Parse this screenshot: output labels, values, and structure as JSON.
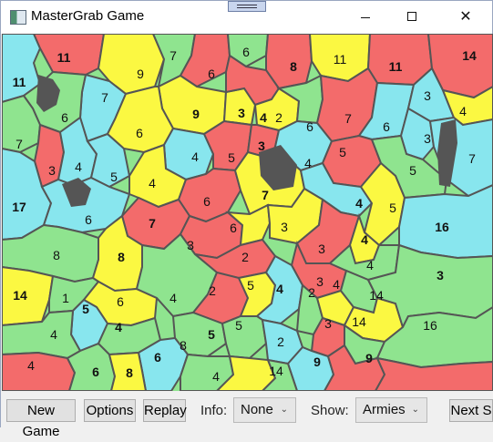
{
  "window": {
    "title": "MasterGrab Game",
    "controls": [
      "minimize",
      "maximize",
      "close"
    ]
  },
  "toolbar": {
    "new_game": "New Game",
    "options": "Options",
    "replay": "Replay",
    "info_label": "Info:",
    "info_value": "None",
    "show_label": "Show:",
    "show_value": "Armies",
    "next": "Next S"
  },
  "map": {
    "colors": {
      "red": "#f36b6b",
      "yellow": "#fbf842",
      "cyan": "#88e6ee",
      "green": "#8fe48f",
      "border": "#555555"
    },
    "regions": [
      {
        "label": "11",
        "bold": true
      },
      {
        "label": "11",
        "bold": true
      },
      {
        "label": "9",
        "bold": false
      },
      {
        "label": "7",
        "bold": false
      },
      {
        "label": "6",
        "bold": false
      },
      {
        "label": "6",
        "bold": false
      },
      {
        "label": "8",
        "bold": true
      },
      {
        "label": "11",
        "bold": false
      },
      {
        "label": "11",
        "bold": true
      },
      {
        "label": "14",
        "bold": true
      },
      {
        "label": "7",
        "bold": false
      },
      {
        "label": "6",
        "bold": false
      },
      {
        "label": "9",
        "bold": true
      },
      {
        "label": "3",
        "bold": true
      },
      {
        "label": "4",
        "bold": true
      },
      {
        "label": "2",
        "bold": false
      },
      {
        "label": "6",
        "bold": false
      },
      {
        "label": "7",
        "bold": false
      },
      {
        "label": "6",
        "bold": false
      },
      {
        "label": "3",
        "bold": false
      },
      {
        "label": "4",
        "bold": false
      },
      {
        "label": "7",
        "bold": false
      },
      {
        "label": "3",
        "bold": false
      },
      {
        "label": "4",
        "bold": false
      },
      {
        "label": "5",
        "bold": false
      },
      {
        "label": "6",
        "bold": false
      },
      {
        "label": "4",
        "bold": false
      },
      {
        "label": "5",
        "bold": false
      },
      {
        "label": "3",
        "bold": true
      },
      {
        "label": "4",
        "bold": false
      },
      {
        "label": "5",
        "bold": false
      },
      {
        "label": "3",
        "bold": false
      },
      {
        "label": "5",
        "bold": false
      },
      {
        "label": "7",
        "bold": false
      },
      {
        "label": "17",
        "bold": true
      },
      {
        "label": "6",
        "bold": false
      },
      {
        "label": "4",
        "bold": false
      },
      {
        "label": "6",
        "bold": false
      },
      {
        "label": "7",
        "bold": true
      },
      {
        "label": "4",
        "bold": true
      },
      {
        "label": "5",
        "bold": false
      },
      {
        "label": "16",
        "bold": true
      },
      {
        "label": "7",
        "bold": true
      },
      {
        "label": "3",
        "bold": false
      },
      {
        "label": "6",
        "bold": false
      },
      {
        "label": "3",
        "bold": false
      },
      {
        "label": "3",
        "bold": false
      },
      {
        "label": "4",
        "bold": true
      },
      {
        "label": "8",
        "bold": false
      },
      {
        "label": "8",
        "bold": true
      },
      {
        "label": "2",
        "bold": false
      },
      {
        "label": "3",
        "bold": false
      },
      {
        "label": "4",
        "bold": false
      },
      {
        "label": "14",
        "bold": true
      },
      {
        "label": "1",
        "bold": false
      },
      {
        "label": "6",
        "bold": false
      },
      {
        "label": "4",
        "bold": false
      },
      {
        "label": "2",
        "bold": false
      },
      {
        "label": "5",
        "bold": false
      },
      {
        "label": "4",
        "bold": true
      },
      {
        "label": "2",
        "bold": false
      },
      {
        "label": "4",
        "bold": false
      },
      {
        "label": "14",
        "bold": false
      },
      {
        "label": "3",
        "bold": true
      },
      {
        "label": "5",
        "bold": true
      },
      {
        "label": "4",
        "bold": false
      },
      {
        "label": "4",
        "bold": true
      },
      {
        "label": "5",
        "bold": true
      },
      {
        "label": "5",
        "bold": false
      },
      {
        "label": "2",
        "bold": false
      },
      {
        "label": "3",
        "bold": false
      },
      {
        "label": "14",
        "bold": false
      },
      {
        "label": "16",
        "bold": false
      },
      {
        "label": "4",
        "bold": false
      },
      {
        "label": "6",
        "bold": true
      },
      {
        "label": "8",
        "bold": false
      },
      {
        "label": "9",
        "bold": true
      },
      {
        "label": "9",
        "bold": true
      },
      {
        "label": "6",
        "bold": true
      },
      {
        "label": "8",
        "bold": true
      },
      {
        "label": "4",
        "bold": false
      },
      {
        "label": "14",
        "bold": false
      }
    ]
  }
}
